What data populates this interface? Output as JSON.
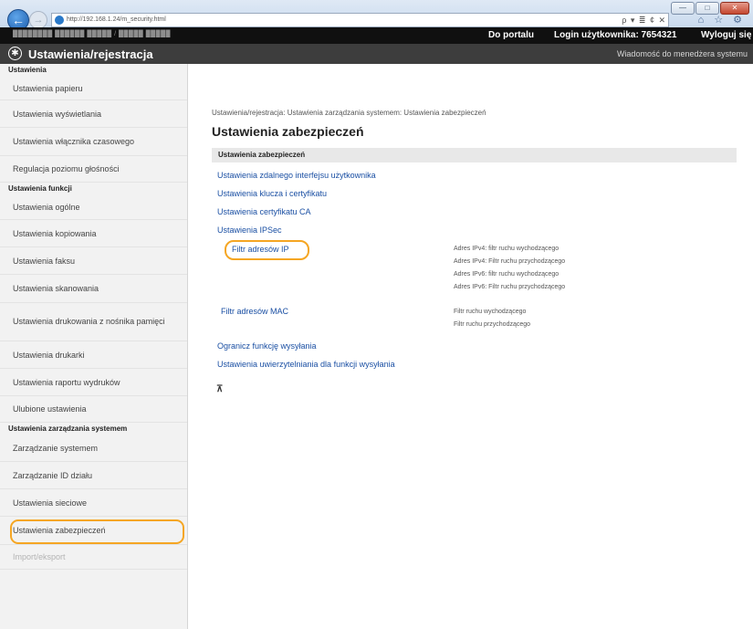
{
  "browser": {
    "url": "http://192.168.1.24/m_security.html",
    "address_actions": "ρ ▾ ≣ ¢ ✕",
    "controls": [
      "—",
      "□",
      "✕"
    ],
    "tool_icons": "⌂ ☆ ⚙"
  },
  "topbar": {
    "device_name": "████████     ██████ █████ / █████ █████",
    "portal_link": "Do portalu",
    "user_info": "Login użytkownika:  7654321",
    "logout_link": "Wyloguj się"
  },
  "header": {
    "title": "Ustawienia/rejestracja",
    "admin_message": "Wiadomość do menedżera systemu"
  },
  "sidebar": {
    "section_settings": "Ustawienia",
    "item_paper": "Ustawienia papieru",
    "item_display": "Ustawienia wyświetlania",
    "item_timer": "Ustawienia włącznika czasowego",
    "item_volume": "Regulacja poziomu głośności",
    "section_functions": "Ustawienia funkcji",
    "item_general": "Ustawienia ogólne",
    "item_copy": "Ustawienia kopiowania",
    "item_fax": "Ustawienia faksu",
    "item_scan": "Ustawienia skanowania",
    "item_media_print": "Ustawienia drukowania z nośnika pamięci",
    "item_printer": "Ustawienia drukarki",
    "item_report": "Ustawienia raportu wydruków",
    "item_favorites": "Ulubione ustawienia",
    "section_management": "Ustawienia zarządzania systemem",
    "item_system_mgmt": "Zarządzanie systemem",
    "item_dept_id": "Zarządzanie ID działu",
    "item_network": "Ustawienia sieciowe",
    "item_security": "Ustawienia zabezpieczeń",
    "item_import_export": "Import/eksport"
  },
  "main": {
    "breadcrumb": "Ustawienia/rejestracja: Ustawienia zarządzania systemem: Ustawienia zabezpieczeń",
    "page_title": "Ustawienia zabezpieczeń",
    "section_title": "Ustawienia zabezpieczeń",
    "link_remote_ui": "Ustawienia zdalnego interfejsu użytkownika",
    "link_keys": "Ustawienia klucza i certyfikatu",
    "link_ca": "Ustawienia certyfikatu CA",
    "link_ipsec": "Ustawienia IPSec",
    "link_ip_filter": "Filtr adresów IP",
    "ip_notes": [
      "Adres IPv4: filtr ruchu wychodzącego",
      "Adres IPv4: Filtr ruchu przychodzącego",
      "Adres IPv6: filtr ruchu wychodzącego",
      "Adres IPv6: Filtr ruchu przychodzącego"
    ],
    "link_mac_filter": "Filtr adresów MAC",
    "mac_notes": [
      "Filtr ruchu wychodzącego",
      "Filtr ruchu przychodzącego"
    ],
    "link_restrict_send": "Ogranicz funkcję wysyłania",
    "link_send_auth": "Ustawienia uwierzytelniania dla funkcji wysyłania",
    "to_top": "⊼"
  }
}
